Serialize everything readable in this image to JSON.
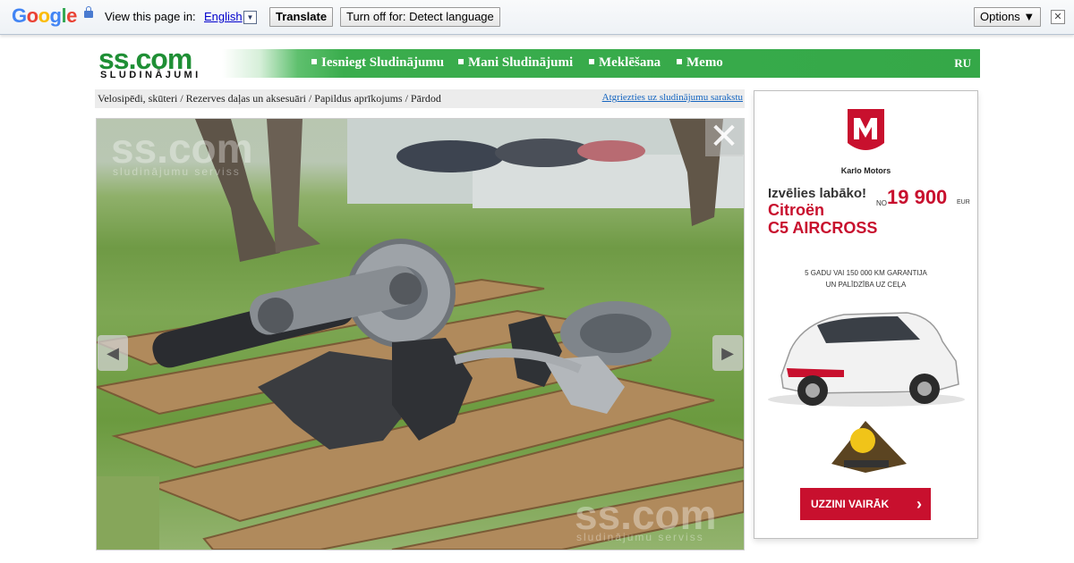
{
  "translate_bar": {
    "logo": "Google",
    "prompt": "View this page in:",
    "language": "English",
    "dropdown": "▼",
    "translate_button": "Translate",
    "turn_off_button": "Turn off for: Detect language",
    "options_button": "Options ▼",
    "close": "✕"
  },
  "header": {
    "logo_main": "ss.com",
    "logo_sub": "SLUDINĀJUMI",
    "menu": [
      {
        "label": "Iesniegt Sludinājumu"
      },
      {
        "label": "Mani Sludinājumi"
      },
      {
        "label": "Meklēšana"
      },
      {
        "label": "Memo"
      }
    ],
    "language": "RU"
  },
  "breadcrumb": {
    "path": "Velosipēdi, skūteri / Rezerves daļas un aksesuāri / Papildus aprīkojums / Pārdod",
    "back_link": "Atgriezties uz sludinājumu sarakstu"
  },
  "photo": {
    "watermark_main": "ss.com",
    "watermark_sub": "sludinājumu serviss",
    "prev": "◀",
    "next": "▶",
    "close": "✕"
  },
  "ad": {
    "brand": "Karlo Motors",
    "headline": "Izvēlies labāko!",
    "price_prefix": "NO",
    "price": "19 900",
    "currency": "EUR",
    "model_line1": "Citroën",
    "model_line2": "C5 AIRCROSS",
    "warranty_line1": "5 GADU VAI 150 000 KM GARANTIJA",
    "warranty_line2": "UN PALĪDZĪBA UZ CEĻA",
    "cta": "UZZINI VAIRĀK",
    "cta_chevron": "›",
    "colors": {
      "accent": "#c8102e"
    }
  },
  "colors": {
    "menu_green": "#35a848",
    "logo_green": "#1f8f35",
    "link_blue": "#1565c0"
  }
}
